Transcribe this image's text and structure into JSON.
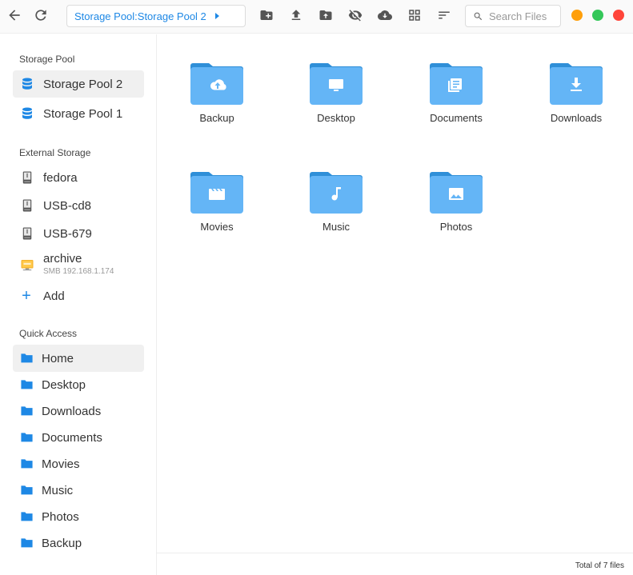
{
  "toolbar": {
    "icons": [
      "back-arrow-icon",
      "refresh-icon",
      "new-folder-icon",
      "upload-icon",
      "upload-folder-icon",
      "hide-hidden-icon",
      "cloud-sync-icon",
      "grid-view-icon",
      "sort-icon"
    ],
    "path": "Storage Pool:Storage Pool 2",
    "search_placeholder": "Search Files",
    "window_colors": {
      "minimize": "#ff9f0a",
      "maximize": "#34c759",
      "close": "#ff453a"
    }
  },
  "sidebar": {
    "storage_pool": {
      "title": "Storage Pool",
      "items": [
        {
          "label": "Storage Pool 2",
          "icon": "database-icon",
          "active": true
        },
        {
          "label": "Storage Pool 1",
          "icon": "database-icon",
          "active": false
        }
      ]
    },
    "external_storage": {
      "title": "External Storage",
      "items": [
        {
          "label": "fedora",
          "icon": "usb-drive-icon"
        },
        {
          "label": "USB-cd8",
          "icon": "usb-drive-icon"
        },
        {
          "label": "USB-679",
          "icon": "usb-drive-icon"
        },
        {
          "label": "archive",
          "sublabel": "SMB 192.168.1.174",
          "icon": "smb-share-icon"
        }
      ],
      "add_label": "Add"
    },
    "quick_access": {
      "title": "Quick Access",
      "items": [
        {
          "label": "Home",
          "active": true
        },
        {
          "label": "Desktop"
        },
        {
          "label": "Downloads"
        },
        {
          "label": "Documents"
        },
        {
          "label": "Movies"
        },
        {
          "label": "Music"
        },
        {
          "label": "Photos"
        },
        {
          "label": "Backup"
        }
      ]
    }
  },
  "files": [
    {
      "name": "Backup",
      "glyph": "cloud-upload-icon"
    },
    {
      "name": "Desktop",
      "glyph": "monitor-icon"
    },
    {
      "name": "Documents",
      "glyph": "documents-icon"
    },
    {
      "name": "Downloads",
      "glyph": "download-icon"
    },
    {
      "name": "Movies",
      "glyph": "clapperboard-icon"
    },
    {
      "name": "Music",
      "glyph": "music-note-icon"
    },
    {
      "name": "Photos",
      "glyph": "image-icon"
    }
  ],
  "status": {
    "total_text": "Total of 7 files"
  },
  "colors": {
    "accent": "#1e88e5",
    "folder_body": "#64b5f6",
    "folder_tab": "#42a5f5",
    "sidebar_folder": "#1e88e5"
  }
}
